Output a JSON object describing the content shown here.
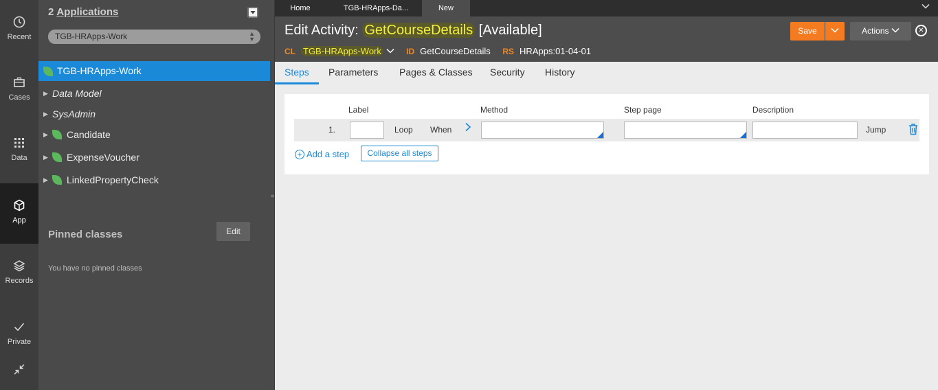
{
  "rail": [
    {
      "label": "Recent",
      "icon": "clock-icon"
    },
    {
      "label": "Cases",
      "icon": "briefcase-icon"
    },
    {
      "label": "Data",
      "icon": "grid-icon"
    },
    {
      "label": "App",
      "icon": "cube-icon",
      "active": true
    },
    {
      "label": "Records",
      "icon": "layers-icon"
    },
    {
      "label": "Private",
      "icon": "check-icon"
    }
  ],
  "explorer": {
    "app_count": "2",
    "app_link": "Applications",
    "app_select_value": "TGB-HRApps-Work",
    "selected_node": "TGB-HRApps-Work",
    "tree": [
      {
        "label": "Data Model",
        "italic": true,
        "leaf": false
      },
      {
        "label": "SysAdmin",
        "italic": true,
        "leaf": false
      },
      {
        "label": "Candidate",
        "italic": false,
        "leaf": true
      },
      {
        "label": "ExpenseVoucher",
        "italic": false,
        "leaf": true
      },
      {
        "label": "LinkedPropertyCheck",
        "italic": false,
        "leaf": true
      }
    ],
    "pinned_title": "Pinned classes",
    "pinned_edit": "Edit",
    "pinned_empty": "You have no pinned classes"
  },
  "tabs": [
    "Home",
    "TGB-HRApps-Da...",
    "New"
  ],
  "header": {
    "title_prefix": "Edit Activity:",
    "title_name": "GetCourseDetails",
    "title_status": "[Available]",
    "cl_key": "CL",
    "cl_value": "TGB-HRApps-Work",
    "id_key": "ID",
    "id_value": "GetCourseDetails",
    "rs_key": "RS",
    "rs_value": "HRApps:01-04-01",
    "save_label": "Save",
    "actions_label": "Actions"
  },
  "subtabs": [
    "Steps",
    "Parameters",
    "Pages & Classes",
    "Security",
    "History"
  ],
  "steps": {
    "headers": {
      "label": "Label",
      "method": "Method",
      "step_page": "Step page",
      "description": "Description"
    },
    "row": {
      "number": "1.",
      "loop": "Loop",
      "when": "When",
      "jump": "Jump",
      "label_value": "",
      "method_value": "",
      "step_page_value": "",
      "description_value": ""
    },
    "add_step": "Add a step",
    "collapse_all": "Collapse all steps"
  },
  "colors": {
    "accent": "#1a8ad8",
    "save": "#f47b20",
    "highlight": "#f4ef3a"
  }
}
